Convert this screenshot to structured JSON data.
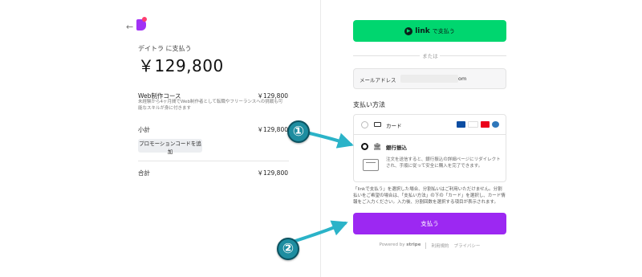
{
  "summary": {
    "back_icon": "arrow-left-icon",
    "pay_to": "デイトラ に支払う",
    "amount": "￥129,800",
    "item": {
      "name": "Web制作コース",
      "price": "￥129,800",
      "desc": "未経験から4ヶ月間でWeb制作者として転職やフリーランスへの挑戦も可能なスキルが身に付きます"
    },
    "subtotal_label": "小計",
    "subtotal_value": "￥129,800",
    "promo_button": "プロモーションコードを追加",
    "total_label": "合計",
    "total_value": "￥129,800"
  },
  "checkout": {
    "link_button": {
      "word": "link",
      "label": "で支払う"
    },
    "or_text": "または",
    "email": {
      "label": "メールアドレス",
      "suffix": "om"
    },
    "payment_method_title": "支払い方法",
    "methods": [
      {
        "label": "カード",
        "selected": false
      },
      {
        "label": "銀行振込",
        "selected": true
      }
    ],
    "card_brands": [
      "JCB",
      "VISA",
      "MC",
      "AMEX"
    ],
    "bank_description": "注文を送信すると、銀行振込の詳細ページにリダイレクトされ、手順に従って安全に購入を完了できます。",
    "note": "「linkで支払う」を選択した場合、分割払いはご利用いただけません。分割払いをご希望の場合は、「支払い方法」の下の「カード」を選択し、カード情報をご入力ください。入力後、分割回数を選択する項目が表示されます。",
    "pay_button": "支払う",
    "footer": {
      "powered_by": "Powered by",
      "brand": "stripe",
      "terms": "利用規約",
      "privacy": "プライバシー"
    }
  },
  "annotations": {
    "badge_1": "①",
    "badge_2": "②",
    "arrow_color": "#2bb3c8"
  },
  "colors": {
    "link_green": "#00d66f",
    "pay_purple": "#9c28f2",
    "brand_purple": "#a132f5"
  }
}
